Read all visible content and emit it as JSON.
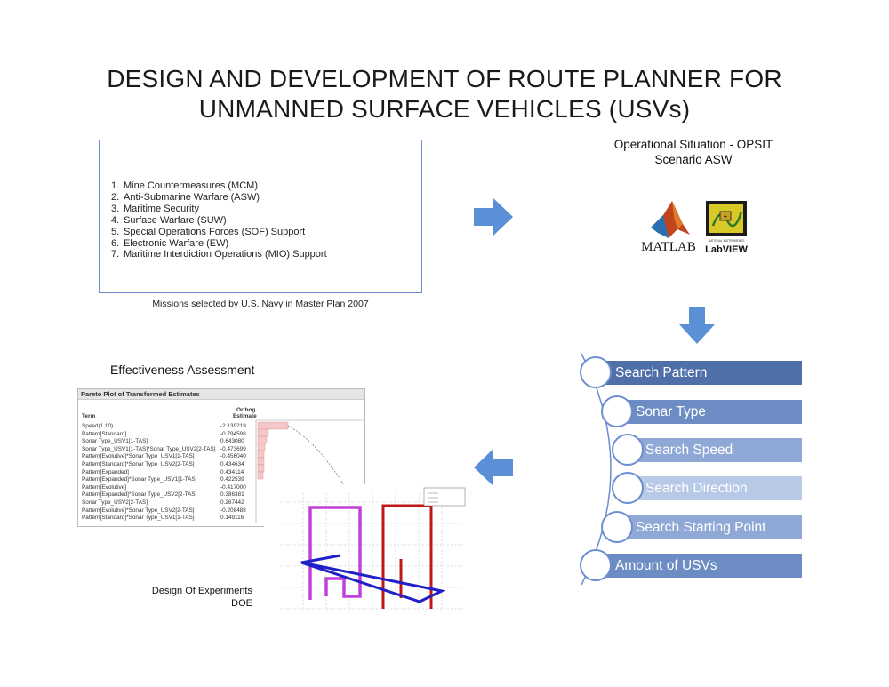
{
  "title": {
    "line1": "DESIGN AND DEVELOPMENT OF ROUTE PLANNER FOR",
    "line2": "UNMANNED SURFACE VEHICLES (USVs)"
  },
  "missions": {
    "items": [
      {
        "num": "1.",
        "text": "Mine Countermeasures (MCM)"
      },
      {
        "num": "2.",
        "text": "Anti-Submarine Warfare (ASW)"
      },
      {
        "num": "3.",
        "text": "Maritime Security"
      },
      {
        "num": "4.",
        "text": "Surface Warfare (SUW)"
      },
      {
        "num": "5.",
        "text": "Special Operations Forces (SOF) Support"
      },
      {
        "num": "6.",
        "text": "Electronic Warfare (EW)"
      },
      {
        "num": "7.",
        "text": "Maritime Interdiction Operations (MIO) Support"
      }
    ],
    "caption": "Missions selected by U.S. Navy in Master Plan 2007"
  },
  "opsit": {
    "line1": "Operational Situation - OPSIT",
    "line2": "Scenario ASW"
  },
  "logos": {
    "matlab": "MATLAB",
    "labview": "LabVIEW",
    "ni_text": "NATIONAL INSTRUMENTS"
  },
  "steps": [
    {
      "label": "Search Pattern",
      "color": "#4f6fa8"
    },
    {
      "label": "Sonar Type",
      "color": "#6d8cc4"
    },
    {
      "label": "Search Speed",
      "color": "#8fa8d6"
    },
    {
      "label": "Search Direction",
      "color": "#b8c9e8"
    },
    {
      "label": "Search Starting Point",
      "color": "#8fa8d6"
    },
    {
      "label": "Amount of USVs",
      "color": "#6d8cc4"
    }
  ],
  "effectiveness": {
    "title": "Effectiveness Assessment",
    "pareto_title": "Pareto Plot of Transformed Estimates",
    "col_term": "Term",
    "col_estimate_1": "Orthog",
    "col_estimate_2": "Estimate",
    "rows": [
      {
        "term": "Speed(1,10)",
        "estimate": "-2.139219"
      },
      {
        "term": "Pattern[Standard]",
        "estimate": "-0.794598"
      },
      {
        "term": "Sonar Type_USV1[1-TAS]",
        "estimate": "0.643080"
      },
      {
        "term": "Sonar Type_USV1[1-TAS]*Sonar Type_USV2[2-TAS]",
        "estimate": "-0.473699"
      },
      {
        "term": "Pattern[Evolutive]*Sonar Type_USV1[1-TAS]",
        "estimate": "-0.456040"
      },
      {
        "term": "Pattern[Standard]*Sonar Type_USV2[2-TAS]",
        "estimate": "0.434634"
      },
      {
        "term": "Pattern[Expanded]",
        "estimate": "0.434114"
      },
      {
        "term": "Pattern[Expanded]*Sonar Type_USV1[1-TAS]",
        "estimate": "0.422539"
      },
      {
        "term": "Pattern[Evolutive]",
        "estimate": "-0.417000"
      },
      {
        "term": "Pattern[Expanded]*Sonar Type_USV2[2-TAS]",
        "estimate": "0.386381"
      },
      {
        "term": "Sonar Type_USV2[2-TAS]",
        "estimate": "0.267442"
      },
      {
        "term": "Pattern[Evolutive]*Sonar Type_USV2[2-TAS]",
        "estimate": "-0.208488"
      },
      {
        "term": "Pattern[Standard]*Sonar Type_USV1[1-TAS]",
        "estimate": "0.149116"
      }
    ]
  },
  "doe": {
    "line1": "Design Of Experiments",
    "line2": "DOE"
  },
  "colors": {
    "arrow": "#5b8fd6",
    "box_border": "#6c8ed0",
    "magenta": "#c040d8",
    "red": "#c01818",
    "blue": "#2020c8"
  }
}
